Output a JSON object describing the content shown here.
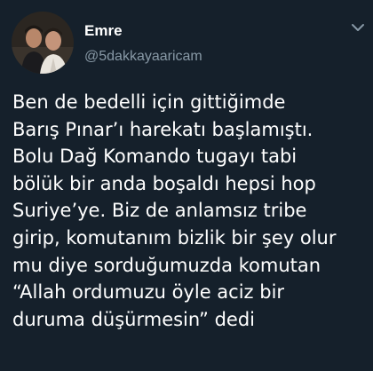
{
  "tweet": {
    "author": {
      "display_name": "Emre",
      "handle": "@5dakkayaaricam",
      "avatar_icon": "profile-photo-icon"
    },
    "menu_icon": "chevron-down-icon",
    "text_lines": [
      "Ben de bedelli için gittiğimde",
      "Barış Pınar’ı harekatı başlamıştı.",
      "Bolu Dağ Komando tugayı tabi",
      "bölük bir anda boşaldı hepsi hop",
      "Suriye’ye. Biz de anlamsız tribe",
      "girip, komutanım bizlik bir şey olur",
      "mu diye sorduğumuzda komutan",
      "“Allah ordumuzu öyle aciz bir",
      "duruma düşürmesin” dedi"
    ]
  },
  "colors": {
    "background": "#15202b",
    "primary_text": "#ffffff",
    "secondary_text": "#8899a6"
  }
}
